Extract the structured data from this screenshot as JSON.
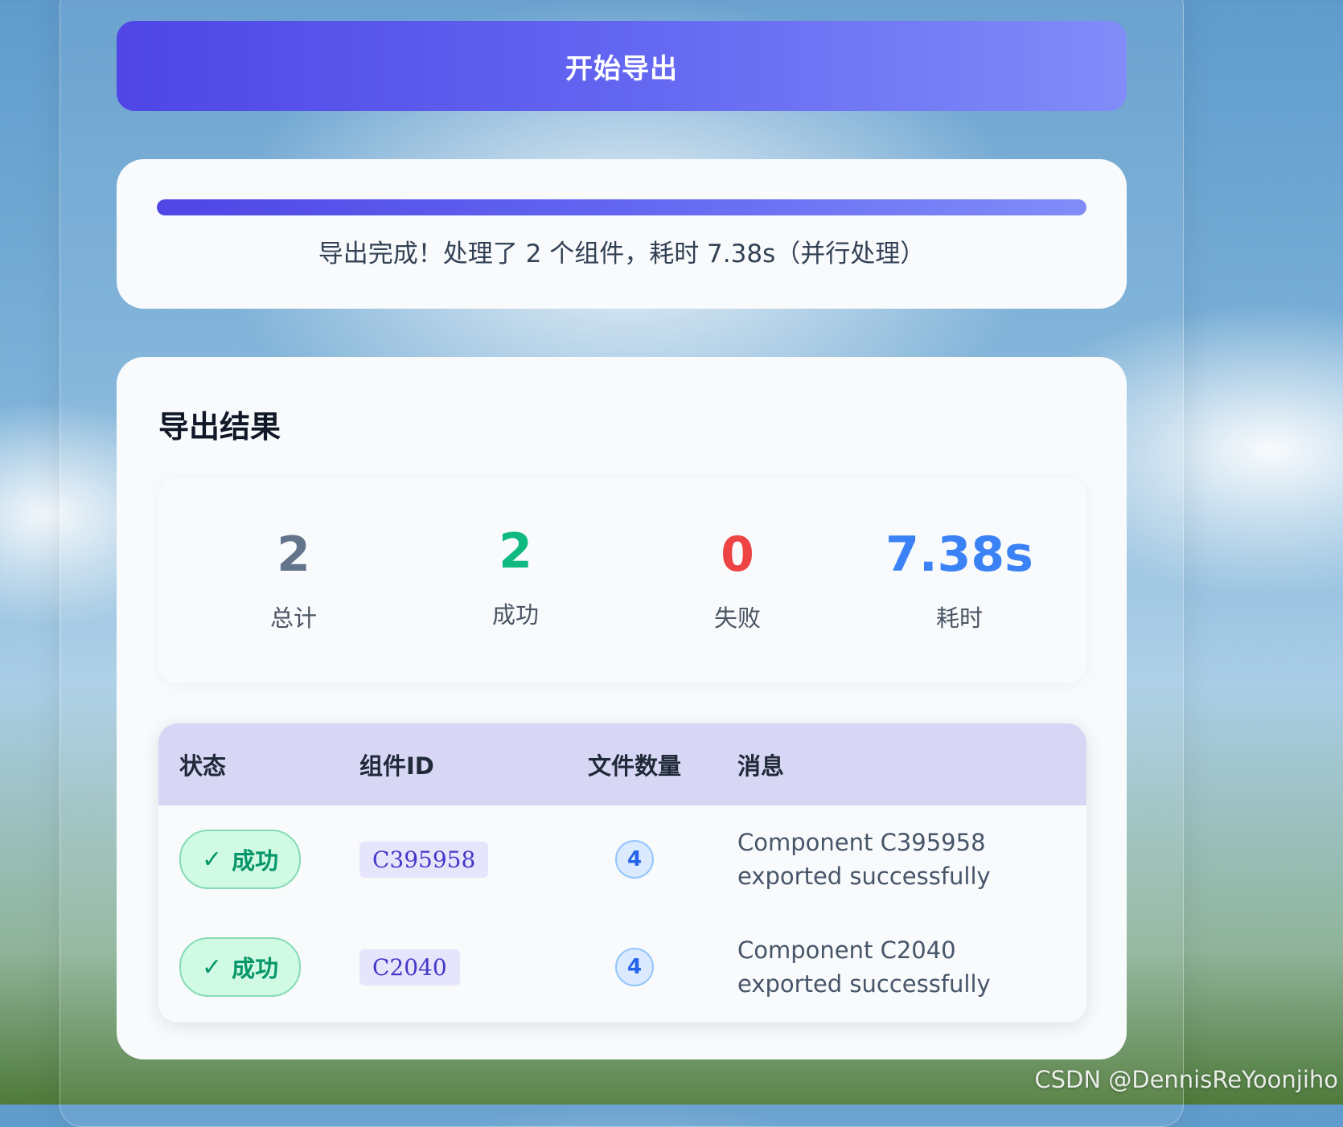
{
  "export_button": {
    "label": "开始导出"
  },
  "progress": {
    "percent": 100,
    "status_text": "导出完成！处理了 2 个组件，耗时 7.38s（并行处理）"
  },
  "results": {
    "title": "导出结果",
    "stats": {
      "total": {
        "value": "2",
        "label": "总计",
        "color": "#64748b"
      },
      "success": {
        "value": "2",
        "label": "成功",
        "color": "#10b981"
      },
      "failed": {
        "value": "0",
        "label": "失败",
        "color": "#ef4444"
      },
      "time": {
        "value": "7.38s",
        "label": "耗时",
        "color": "#3b82f6"
      }
    },
    "table": {
      "headers": {
        "status": "状态",
        "component_id": "组件ID",
        "file_count": "文件数量",
        "message": "消息"
      },
      "rows": [
        {
          "status": "成功",
          "component_id": "C395958",
          "file_count": "4",
          "message_line1": "Component C395958",
          "message_line2": "exported successfully"
        },
        {
          "status": "成功",
          "component_id": "C2040",
          "file_count": "4",
          "message_line1": "Component C2040",
          "message_line2": "exported successfully"
        }
      ]
    }
  },
  "watermark": "CSDN @DennisReYoonjiho",
  "icons": {
    "status": "check-icon"
  },
  "colors": {
    "accent_start": "#4f46e5",
    "accent_end": "#818cf8",
    "success": "#10b981",
    "failed": "#ef4444",
    "time": "#3b82f6"
  }
}
